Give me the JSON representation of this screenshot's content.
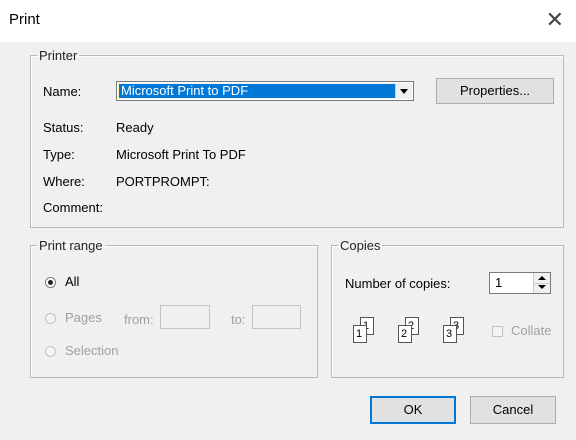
{
  "window": {
    "title": "Print",
    "close_icon": "close-icon"
  },
  "printer": {
    "group_label": "Printer",
    "name_label": "Name:",
    "name_value": "Microsoft Print to PDF",
    "properties_label": "Properties...",
    "status_label": "Status:",
    "status_value": "Ready",
    "type_label": "Type:",
    "type_value": "Microsoft Print To PDF",
    "where_label": "Where:",
    "where_value": "PORTPROMPT:",
    "comment_label": "Comment:",
    "comment_value": ""
  },
  "print_range": {
    "group_label": "Print range",
    "all_label": "All",
    "pages_label": "Pages",
    "from_label": "from:",
    "from_value": "",
    "to_label": "to:",
    "to_value": "",
    "selection_label": "Selection",
    "selected": "All"
  },
  "copies": {
    "group_label": "Copies",
    "number_label": "Number of copies:",
    "number_value": "1",
    "collate_label": "Collate",
    "collate_checked": false,
    "page_numbers": [
      "1",
      "1",
      "2",
      "2",
      "3",
      "3"
    ]
  },
  "footer": {
    "ok_label": "OK",
    "cancel_label": "Cancel"
  },
  "colors": {
    "accent": "#0078d7",
    "background": "#f0f0f0"
  }
}
